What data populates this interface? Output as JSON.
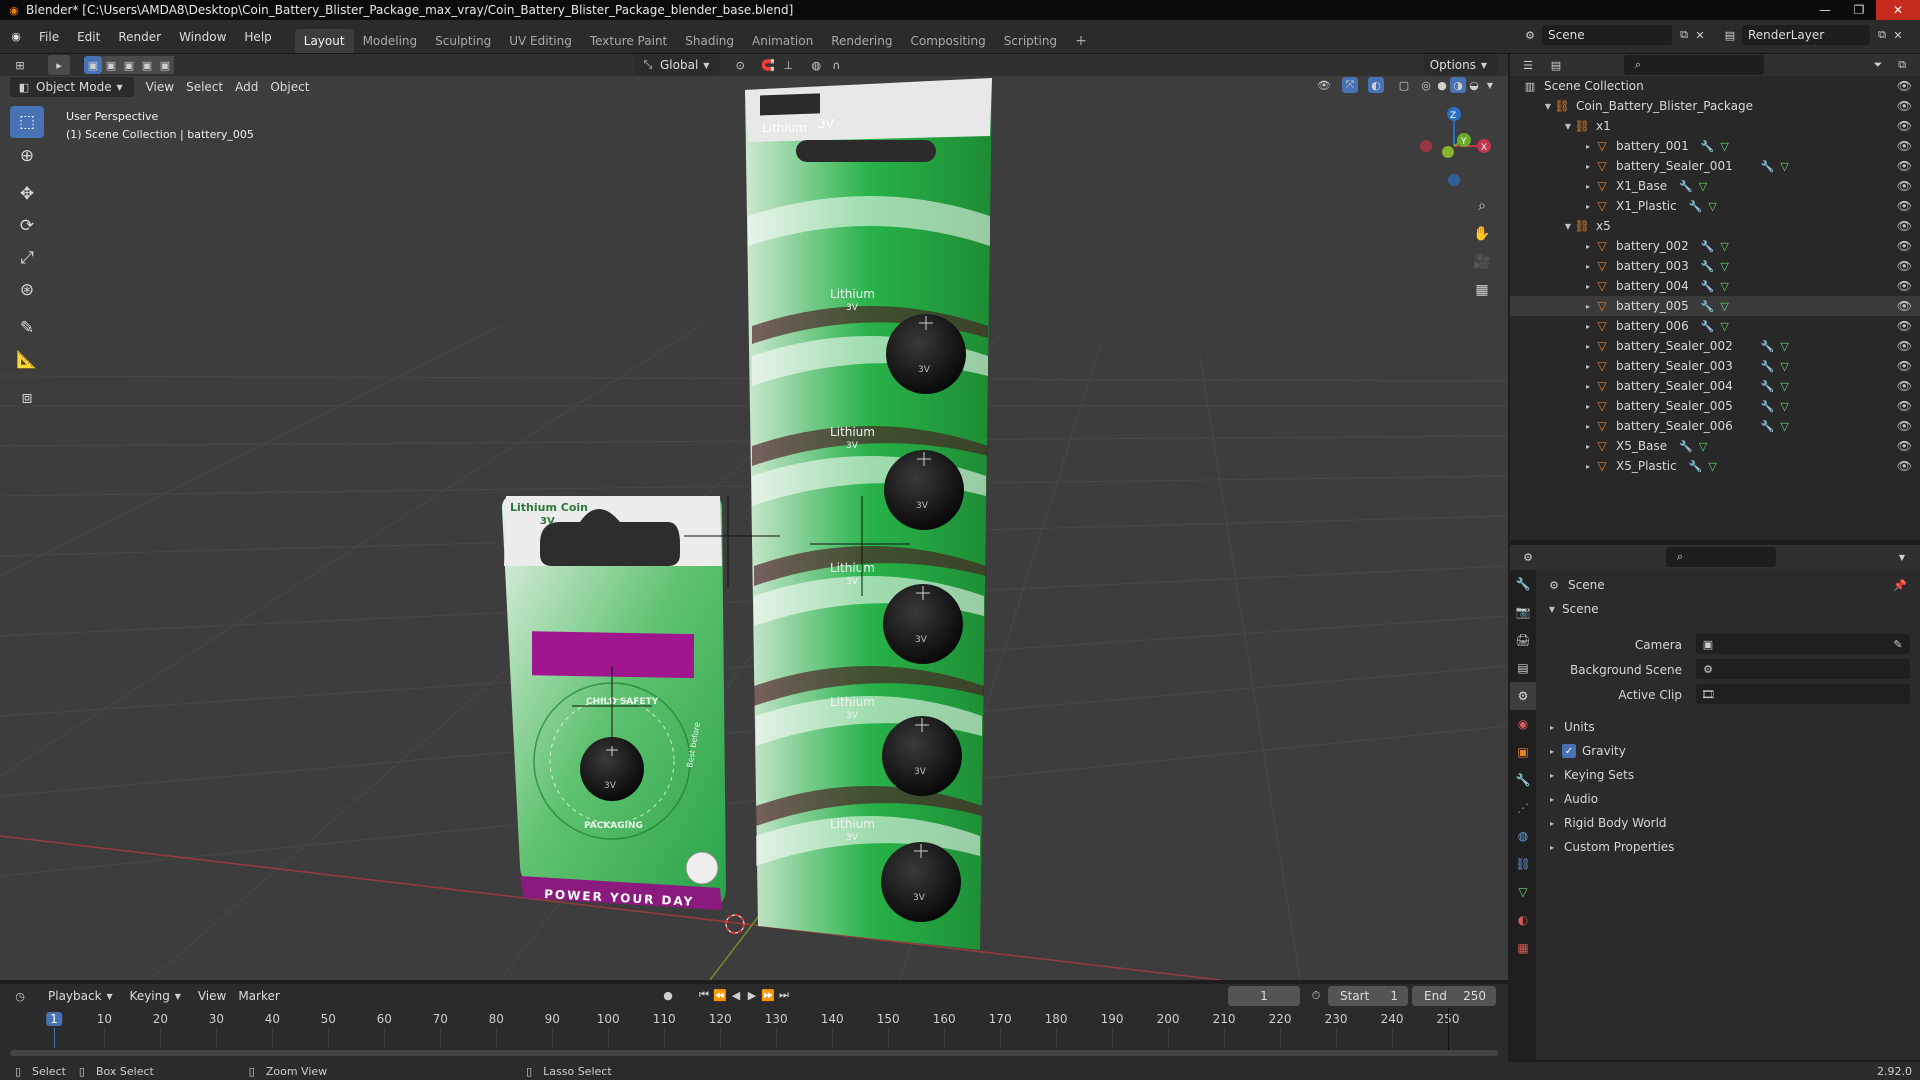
{
  "window": {
    "title": "Blender* [C:\\Users\\AMDA8\\Desktop\\Coin_Battery_Blister_Package_max_vray/Coin_Battery_Blister_Package_blender_base.blend]"
  },
  "menu": [
    "File",
    "Edit",
    "Render",
    "Window",
    "Help"
  ],
  "workspaces": [
    "Layout",
    "Modeling",
    "Sculpting",
    "UV Editing",
    "Texture Paint",
    "Shading",
    "Animation",
    "Rendering",
    "Compositing",
    "Scripting"
  ],
  "active_workspace": "Layout",
  "scene_field": "Scene",
  "view_layer_field": "RenderLayer",
  "tool_header": {
    "orientation": "Global",
    "options": "Options"
  },
  "viewport_header": {
    "mode": "Object Mode",
    "menus": [
      "View",
      "Select",
      "Add",
      "Object"
    ]
  },
  "viewport_info": {
    "line1": "User Perspective",
    "line2": "(1) Scene Collection | battery_005"
  },
  "gizmo": {
    "z": "Z",
    "y": "Y",
    "x": "X"
  },
  "packages": {
    "small": {
      "label1": "Lithium Coin",
      "label2": "3V",
      "cell": "3V",
      "ring1": "CHILD SAFETY",
      "ring2": "PACKAGING",
      "best": "Best before",
      "footer": "POWER YOUR DAY"
    },
    "large": {
      "label": "Lithium",
      "volt": "3V",
      "cells": [
        "3V",
        "3V",
        "3V",
        "3V",
        "3V"
      ],
      "strip_labels": [
        "Lithium",
        "Lithium",
        "Lithium",
        "Lithium",
        "Lithium"
      ],
      "strip_volts": [
        "3V",
        "3V",
        "3V",
        "3V",
        "3V"
      ]
    }
  },
  "outliner": {
    "root": "Scene Collection",
    "package": "Coin_Battery_Blister_Package",
    "groups": [
      {
        "name": "x1",
        "items": [
          "battery_001",
          "battery_Sealer_001",
          "X1_Base",
          "X1_Plastic"
        ]
      },
      {
        "name": "x5",
        "items": [
          "battery_002",
          "battery_003",
          "battery_004",
          "battery_005",
          "battery_006",
          "battery_Sealer_002",
          "battery_Sealer_003",
          "battery_Sealer_004",
          "battery_Sealer_005",
          "battery_Sealer_006",
          "X5_Base",
          "X5_Plastic"
        ]
      }
    ],
    "selected": "battery_005"
  },
  "properties": {
    "context": "Scene",
    "panel": "Scene",
    "fields": [
      {
        "label": "Camera"
      },
      {
        "label": "Background Scene"
      },
      {
        "label": "Active Clip"
      }
    ],
    "panels": [
      "Units",
      "Gravity",
      "Keying Sets",
      "Audio",
      "Rigid Body World",
      "Custom Properties"
    ],
    "gravity_checked": true
  },
  "timeline": {
    "menus": [
      "Playback",
      "Keying",
      "View",
      "Marker"
    ],
    "current_frame": "1",
    "start_label": "Start",
    "start": "1",
    "end_label": "End",
    "end": "250",
    "ticks": [
      "1",
      "10",
      "20",
      "30",
      "40",
      "50",
      "60",
      "70",
      "80",
      "90",
      "100",
      "110",
      "120",
      "130",
      "140",
      "150",
      "160",
      "170",
      "180",
      "190",
      "200",
      "210",
      "220",
      "230",
      "240",
      "250"
    ]
  },
  "status": {
    "select": "Select",
    "box_select": "Box Select",
    "zoom_view": "Zoom View",
    "lasso_select": "Lasso Select",
    "version": "2.92.0"
  },
  "colors": {
    "accent": "#4772b3",
    "object": "#e8822a",
    "mesh": "#6bd86b",
    "package_green": "#2fb84a",
    "magenta": "#a0168f"
  }
}
